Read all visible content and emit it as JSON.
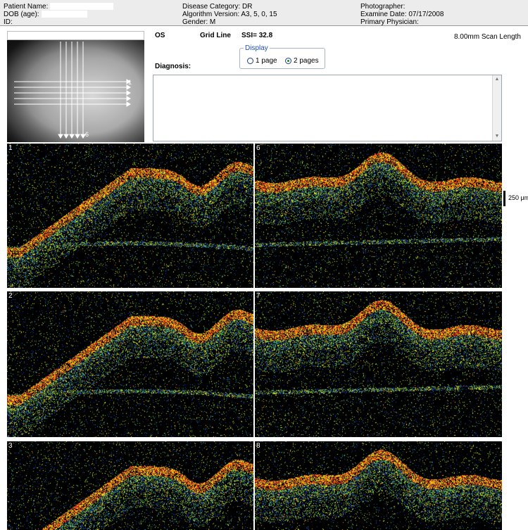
{
  "header": {
    "patient_name_label": "Patient Name:",
    "dob_label": "DOB (age):",
    "id_label": "ID:",
    "disease_category": "Disease Category: DR",
    "algorithm_version": "Algorithm Version: A3, 5, 0, 15",
    "gender": "Gender: M",
    "photographer": "Photographer:",
    "exam_date": "Examine Date: 07/17/2008",
    "primary_physician": "Primary Physician:"
  },
  "eye": "OS",
  "scan_type": "Grid Line",
  "ssi": "SSI= 32.8",
  "scan_length": "8.00mm Scan Length",
  "display": {
    "legend": "Display",
    "option1": "1 page",
    "option2": "2 pages",
    "selected": "2 pages"
  },
  "diagnosis_label": "Diagnosis:",
  "diagnosis_text": "",
  "fundus": {
    "horizontal_line_label": "1",
    "vertical_line_label": "6"
  },
  "scans": [
    {
      "label": "1"
    },
    {
      "label": "6"
    },
    {
      "label": "2"
    },
    {
      "label": "7"
    },
    {
      "label": "3"
    },
    {
      "label": "8"
    }
  ],
  "scale": {
    "label": "250 μm"
  },
  "colors": {
    "header_bg": "#ececec",
    "scan_bg": "#000000",
    "display_legend": "#1f4fbf"
  }
}
